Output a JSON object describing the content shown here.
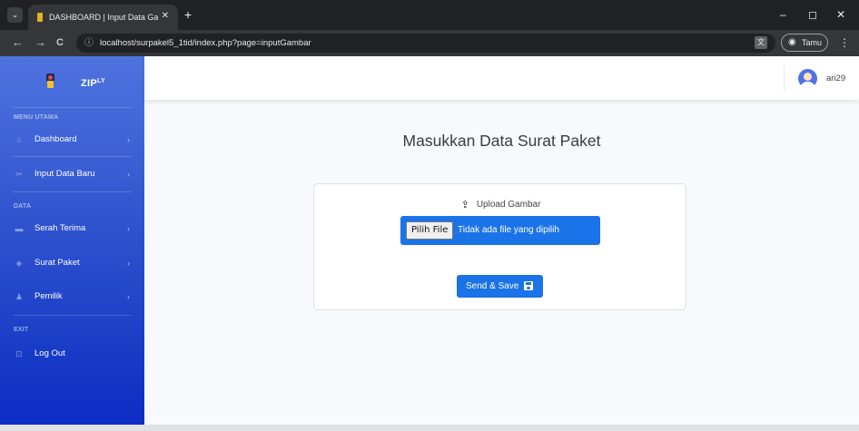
{
  "browser": {
    "tab_title": "DASHBOARD | Input Data Gamb",
    "tab_close": "✕",
    "new_tab": "+",
    "menu_glyph": "⌄",
    "url": "localhost/surpakel5_1tid/index.php?page=inputGambar",
    "profile_label": "Tamu",
    "nav_back": "←",
    "nav_forward": "→",
    "nav_reload": "C",
    "info_glyph": "ⓘ",
    "translate_glyph": "文",
    "profile_glyph": "◉",
    "kebab_glyph": "⋮",
    "minimize": "–",
    "restore": "◻",
    "close": "✕"
  },
  "sidebar": {
    "brand": "ZIP",
    "brand_sup": "LY",
    "sections": {
      "main": "MENU UTAMA",
      "data": "DATA",
      "exit": "EXIT"
    },
    "items": [
      {
        "label": "Dashboard",
        "icon": "home-icon",
        "glyph": "⌂",
        "chevron": "›"
      },
      {
        "label": "Input Data Baru",
        "icon": "tools-icon",
        "glyph": "✂",
        "chevron": "›"
      },
      {
        "label": "Serah Terima",
        "icon": "briefcase-icon",
        "glyph": "▬",
        "chevron": "›"
      },
      {
        "label": "Surat Paket",
        "icon": "cube-icon",
        "glyph": "◈",
        "chevron": "›"
      },
      {
        "label": "Pemilik",
        "icon": "user-icon",
        "glyph": "♟",
        "chevron": "›"
      },
      {
        "label": "Log Out",
        "icon": "unlock-icon",
        "glyph": "⊡"
      }
    ]
  },
  "topbar": {
    "username": "ari29"
  },
  "main": {
    "title": "Masukkan Data Surat Paket",
    "upload_label": "Upload Gambar",
    "upload_glyph": "⇪",
    "file_button": "Pilih File",
    "file_status": "Tidak ada file yang dipilih",
    "submit_label": "Send & Save"
  },
  "colors": {
    "sidebar_top": "#4e73df",
    "sidebar_bottom": "#0c2cc4",
    "primary_button": "#1a73e8",
    "browser_dark": "#202124"
  }
}
